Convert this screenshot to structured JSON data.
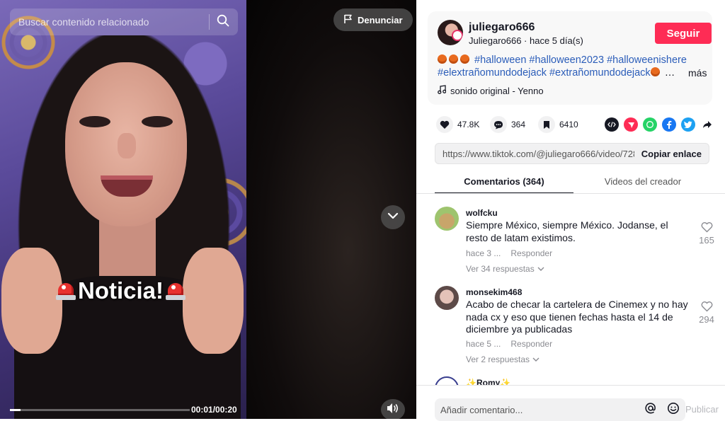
{
  "video": {
    "search_placeholder": "Buscar contenido relacionado",
    "report_label": "Denunciar",
    "overlay_text": "Noticia!",
    "time": "00:01/00:20",
    "progress": 0.06
  },
  "author": {
    "username": "juliegaro666",
    "subtitle": "Juliegaro666 · hace 5 día(s)",
    "follow_label": "Seguir"
  },
  "description": {
    "line1_tags": "#halloween #halloween2023 #halloweenishere",
    "line2_tags": "#elextrañomundodejack #extrañomundodejack",
    "more_label": "más",
    "sound": "sonido original - Yenno"
  },
  "stats": {
    "likes": "47.8K",
    "comments": "364",
    "saves": "6410"
  },
  "link": {
    "url": "https://www.tiktok.com/@juliegaro666/video/728...",
    "copy_label": "Copiar enlace"
  },
  "tabs": [
    {
      "label": "Comentarios (364)"
    },
    {
      "label": "Videos del creador"
    }
  ],
  "comments": [
    {
      "user": "wolfcku",
      "text": "Siempre México, siempre México. Jodanse, el resto de latam existimos.",
      "time": "hace 3 ...",
      "reply_label": "Responder",
      "replies": "Ver 34 respuestas",
      "likes": "165"
    },
    {
      "user": "monsekim468",
      "text": "Acabo de checar la cartelera de Cinemex y no hay nada cx y eso que tienen fechas hasta el 14 de diciembre ya publicadas",
      "time": "hace 5 ...",
      "reply_label": "Responder",
      "replies": "Ver 2 respuestas",
      "likes": "294"
    },
    {
      "user": "✨Romy✨"
    }
  ],
  "comment_box": {
    "placeholder": "Añadir comentario...",
    "post_label": "Publicar"
  },
  "colors": {
    "accent": "#fe2c55",
    "hashtag": "#2b5db9"
  }
}
